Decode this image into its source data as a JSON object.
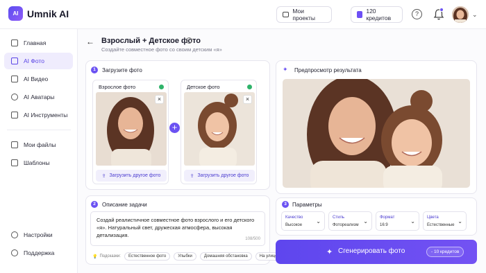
{
  "app": {
    "name": "Umnik AI",
    "logo_mark": "AI"
  },
  "topbar": {
    "projects_label": "Мои проекты",
    "credits_label": "120 кредитов",
    "help_icon": "?",
    "notification_icon": "bell-icon"
  },
  "sidebar": {
    "items": [
      {
        "label": "Главная",
        "icon": "home-icon"
      },
      {
        "label": "AI Фото",
        "icon": "image-icon",
        "active": true
      },
      {
        "label": "AI Видео",
        "icon": "video-icon"
      },
      {
        "label": "AI Аватары",
        "icon": "avatar-icon"
      },
      {
        "label": "AI Инструменты",
        "icon": "tools-icon"
      },
      {
        "label": "Мои файлы",
        "icon": "folder-icon"
      },
      {
        "label": "Шаблоны",
        "icon": "grid-icon"
      }
    ],
    "bottom": [
      {
        "label": "Настройки",
        "icon": "gear-icon"
      },
      {
        "label": "Поддержка",
        "icon": "support-icon"
      }
    ]
  },
  "page": {
    "title": "Взрослый + Детское фото",
    "subtitle": "Создайте совместное фото со своим детским «я»"
  },
  "upload": {
    "step": "1",
    "title": "Загрузите фото",
    "adult_label": "Взрослое фото",
    "child_label": "Детское фото",
    "upload_other": "Загрузить другое фото"
  },
  "preview": {
    "title": "Предпросмотр результата"
  },
  "task": {
    "step": "2",
    "title": "Описание задачи",
    "text": "Создай реалистичное совместное фото взрослого и его детского «я». Натуральный свет, дружеская атмосфера, высокая детализация.",
    "counter": "108/500",
    "hints_label": "Подсказки:",
    "hints": [
      "Естественное фото",
      "Улыбки",
      "Домашняя обстановка",
      "На улице"
    ]
  },
  "params": {
    "step": "3",
    "title": "Параметры",
    "items": [
      {
        "label": "Качество",
        "value": "Высокое"
      },
      {
        "label": "Стиль",
        "value": "Фотореализм"
      },
      {
        "label": "Формат",
        "value": "16:9"
      },
      {
        "label": "Цвета",
        "value": "Естественные"
      }
    ]
  },
  "generate": {
    "label": "Сгенерировать фото",
    "cost": "- 10 кредитов"
  },
  "colors": {
    "accent": "#6b52f2",
    "active_bg": "#efecfd",
    "success": "#2fb36a"
  }
}
